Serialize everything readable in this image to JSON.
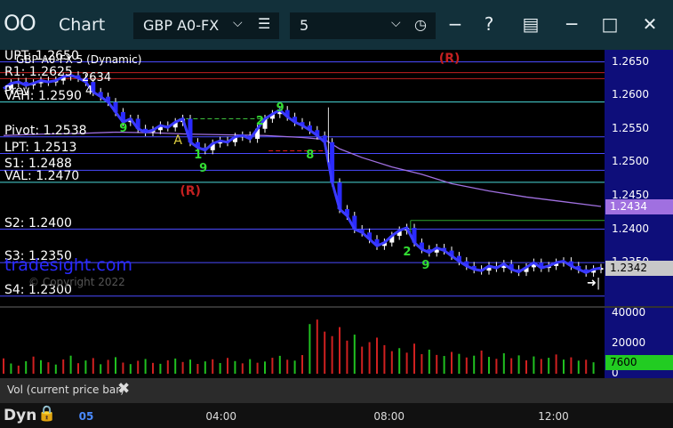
{
  "window": {
    "title": "Chart",
    "symbol": "GBP A0-FX",
    "interval": "5",
    "help_label": "?"
  },
  "chart_data": {
    "type": "candlestick",
    "study_label": "GBP A0-FX 5 (Dynamic)",
    "watermark": "tradesight.com",
    "copyright": "© Copyright 2022",
    "y_ticks": [
      "1.2650",
      "1.2600",
      "1.2550",
      "1.2500",
      "1.2450",
      "1.2400",
      "1.2350"
    ],
    "ylim": [
      1.2285,
      1.2668
    ],
    "levels": [
      {
        "label": "UPT: 1.2650",
        "value": 1.265,
        "color": "#4a4aff"
      },
      {
        "label": "R1: 1.2625",
        "value": 1.2625,
        "color": "#c02020"
      },
      {
        "label": "",
        "value": 1.2634,
        "color": "#c02020"
      },
      {
        "label": "VAH: 1.2590",
        "value": 1.259,
        "color": "#4ad8d8"
      },
      {
        "label": "Pivot: 1.2538",
        "value": 1.2538,
        "color": "#4a4aff"
      },
      {
        "label": "LPT: 1.2513",
        "value": 1.2513,
        "color": "#4a4aff"
      },
      {
        "label": "S1: 1.2488",
        "value": 1.2488,
        "color": "#4a4aff"
      },
      {
        "label": "VAL: 1.2470",
        "value": 1.247,
        "color": "#4ad8d8"
      },
      {
        "label": "S2: 1.2400",
        "value": 1.24,
        "color": "#4a4aff"
      },
      {
        "label": "S3: 1.2350",
        "value": 1.235,
        "color": "#4a4aff"
      },
      {
        "label": "S4: 1.2300",
        "value": 1.23,
        "color": "#4a4aff"
      }
    ],
    "extra_labels": {
      "r1_extra": "2634",
      "prev": "Prev",
      "val_suffix": "4"
    },
    "avg_price": "1.2434",
    "last_price": "1.2342",
    "avg_color": "#a070e0",
    "r_markers": [
      {
        "text": "(R)",
        "x": 59.5,
        "y": 1.2654
      },
      {
        "text": "(R)",
        "x": 24.8,
        "y": 1.2455
      }
    ],
    "a_marker": {
      "text": "A",
      "x": 23.5,
      "y": 1.2536
    },
    "seq_labels": [
      {
        "text": "9",
        "x": 36.5,
        "y": 1.258
      },
      {
        "text": "2",
        "x": 33.8,
        "y": 1.256
      },
      {
        "text": "8",
        "x": 40.5,
        "y": 1.251
      },
      {
        "text": "1",
        "x": 25.5,
        "y": 1.251
      },
      {
        "text": "9",
        "x": 26.2,
        "y": 1.249
      },
      {
        "text": "2",
        "x": 53.5,
        "y": 1.2365
      },
      {
        "text": "9",
        "x": 56.0,
        "y": 1.2345
      },
      {
        "text": "9",
        "x": 15.5,
        "y": 1.255
      }
    ],
    "prices": [
      [
        0,
        1.261
      ],
      [
        1,
        1.2618
      ],
      [
        2,
        1.262
      ],
      [
        3,
        1.2615
      ],
      [
        4,
        1.2618
      ],
      [
        5,
        1.2622
      ],
      [
        6,
        1.262
      ],
      [
        7,
        1.2622
      ],
      [
        8,
        1.2628
      ],
      [
        9,
        1.263
      ],
      [
        10,
        1.2626
      ],
      [
        11,
        1.262
      ],
      [
        12,
        1.2605
      ],
      [
        13,
        1.2598
      ],
      [
        14,
        1.259
      ],
      [
        15,
        1.2575
      ],
      [
        16,
        1.256
      ],
      [
        17,
        1.2565
      ],
      [
        18,
        1.255
      ],
      [
        19,
        1.2545
      ],
      [
        20,
        1.2548
      ],
      [
        21,
        1.2555
      ],
      [
        22,
        1.2552
      ],
      [
        23,
        1.256
      ],
      [
        24,
        1.2565
      ],
      [
        25,
        1.253
      ],
      [
        26,
        1.2522
      ],
      [
        27,
        1.2518
      ],
      [
        28,
        1.2528
      ],
      [
        29,
        1.2532
      ],
      [
        30,
        1.253
      ],
      [
        31,
        1.2538
      ],
      [
        32,
        1.254
      ],
      [
        33,
        1.2535
      ],
      [
        34,
        1.255
      ],
      [
        35,
        1.2565
      ],
      [
        36,
        1.2572
      ],
      [
        37,
        1.2578
      ],
      [
        38,
        1.2568
      ],
      [
        39,
        1.256
      ],
      [
        40,
        1.2555
      ],
      [
        41,
        1.2548
      ],
      [
        42,
        1.254
      ],
      [
        43,
        1.253
      ],
      [
        44,
        1.247
      ],
      [
        45,
        1.243
      ],
      [
        46,
        1.242
      ],
      [
        47,
        1.24
      ],
      [
        48,
        1.2395
      ],
      [
        49,
        1.2385
      ],
      [
        50,
        1.2375
      ],
      [
        51,
        1.238
      ],
      [
        52,
        1.239
      ],
      [
        53,
        1.2398
      ],
      [
        54,
        1.2402
      ],
      [
        55,
        1.238
      ],
      [
        56,
        1.237
      ],
      [
        57,
        1.2365
      ],
      [
        58,
        1.2372
      ],
      [
        59,
        1.2368
      ],
      [
        60,
        1.236
      ],
      [
        61,
        1.2352
      ],
      [
        62,
        1.2345
      ],
      [
        63,
        1.234
      ],
      [
        64,
        1.2338
      ],
      [
        65,
        1.2345
      ],
      [
        66,
        1.2342
      ],
      [
        67,
        1.2348
      ],
      [
        68,
        1.234
      ],
      [
        69,
        1.2336
      ],
      [
        70,
        1.2343
      ],
      [
        71,
        1.235
      ],
      [
        72,
        1.2342
      ],
      [
        73,
        1.2345
      ],
      [
        74,
        1.235
      ],
      [
        75,
        1.2352
      ],
      [
        76,
        1.2345
      ],
      [
        77,
        1.234
      ],
      [
        78,
        1.2335
      ],
      [
        79,
        1.234
      ],
      [
        80,
        1.2342
      ]
    ],
    "ma": [
      [
        0,
        1.254
      ],
      [
        5,
        1.2542
      ],
      [
        10,
        1.2543
      ],
      [
        15,
        1.2545
      ],
      [
        20,
        1.2544
      ],
      [
        25,
        1.2542
      ],
      [
        30,
        1.2541
      ],
      [
        35,
        1.254
      ],
      [
        40,
        1.2537
      ],
      [
        43,
        1.2534
      ],
      [
        45,
        1.252
      ],
      [
        48,
        1.2507
      ],
      [
        52,
        1.2493
      ],
      [
        56,
        1.2482
      ],
      [
        60,
        1.2468
      ],
      [
        65,
        1.2457
      ],
      [
        70,
        1.2448
      ],
      [
        75,
        1.2441
      ],
      [
        80,
        1.2434
      ]
    ],
    "volume": {
      "y_ticks": [
        "40000",
        "20000",
        "0"
      ],
      "ylim": [
        0,
        42000
      ],
      "current": "7600",
      "label": "Vol (current price bar)",
      "values": [
        10200,
        6800,
        5400,
        8300,
        11400,
        9000,
        7600,
        6100,
        9500,
        12000,
        7000,
        8800,
        10400,
        6300,
        9200,
        11000,
        7400,
        6400,
        8600,
        9800,
        7200,
        6600,
        8900,
        10100,
        7800,
        9400,
        6500,
        8200,
        9600,
        7100,
        10500,
        8400,
        6900,
        9700,
        7300,
        8100,
        10600,
        11900,
        9300,
        8700,
        12400,
        33000,
        36000,
        28000,
        25000,
        31000,
        22000,
        26000,
        18000,
        21000,
        24000,
        19000,
        15000,
        17000,
        14000,
        20000,
        13000,
        16000,
        12500,
        11800,
        14500,
        13200,
        10800,
        12000,
        15400,
        11200,
        9900,
        13600,
        10300,
        12200,
        8900,
        11500,
        9800,
        10600,
        12800,
        9400,
        10900,
        8700,
        9300,
        7600
      ]
    },
    "x_ticks": [
      {
        "label": "05",
        "x": 11.5
      },
      {
        "label": "04:00",
        "x": 28.5
      },
      {
        "label": "08:00",
        "x": 51.0
      },
      {
        "label": "12:00",
        "x": 73.0
      }
    ]
  },
  "bottom": {
    "dyn": "Dyn"
  }
}
